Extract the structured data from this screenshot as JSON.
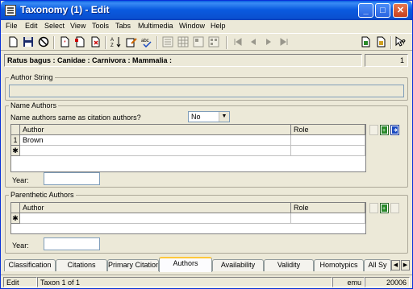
{
  "window": {
    "title": "Taxonomy (1) - Edit"
  },
  "menu": [
    "File",
    "Edit",
    "Select",
    "View",
    "Tools",
    "Tabs",
    "Multimedia",
    "Window",
    "Help"
  ],
  "record": {
    "path": "Ratus bagus : Canidae : Carnivora : Mammalia :",
    "number": "1"
  },
  "author_string": {
    "title": "Author String",
    "value": ""
  },
  "name_authors": {
    "title": "Name Authors",
    "same_label": "Name authors same as citation authors?",
    "same_value": "No",
    "columns": [
      "Author",
      "Role"
    ],
    "rows": [
      {
        "num": "1",
        "author": "Brown",
        "role": ""
      }
    ],
    "new_row_marker": "✱",
    "year_label": "Year:",
    "year_value": ""
  },
  "parenthetic_authors": {
    "title": "Parenthetic Authors",
    "columns": [
      "Author",
      "Role"
    ],
    "new_row_marker": "✱",
    "year_label": "Year:",
    "year_value": ""
  },
  "tabs": [
    "Classification",
    "Citations",
    "Primary Citation",
    "Authors",
    "Availability",
    "Validity",
    "Homotypics",
    "All Sy"
  ],
  "active_tab": "Authors",
  "status": {
    "mode": "Edit",
    "record": "Taxon 1 of 1",
    "db": "emu",
    "port": "20006"
  },
  "colors": {
    "titlebar": "#0a5be0",
    "active_tab_accent": "#ffc83c",
    "window_bg": "#ece9d8"
  }
}
